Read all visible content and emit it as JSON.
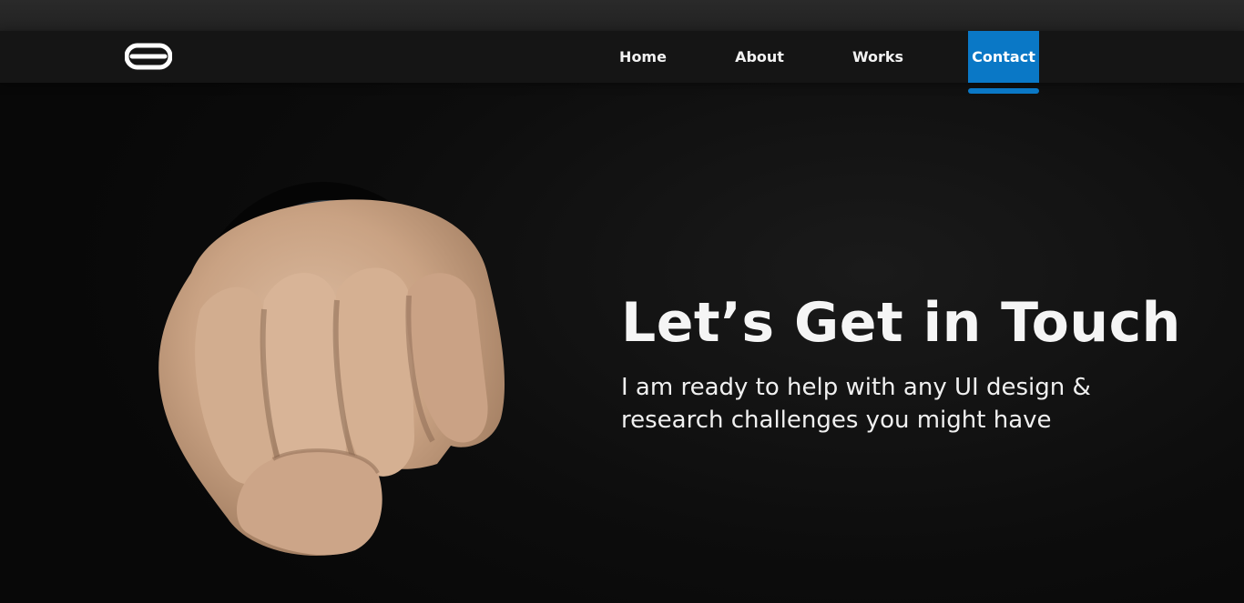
{
  "brand": {
    "logo_icon": "link-logo-icon"
  },
  "nav": {
    "items": [
      {
        "label": "Home"
      },
      {
        "label": "About"
      },
      {
        "label": "Works"
      },
      {
        "label": "Contact",
        "active": true
      }
    ],
    "accent_color": "#0a78c6"
  },
  "hero": {
    "image": "fist-bump-3d-icon",
    "headline": "Let’s Get in Touch",
    "subtext": "I am ready to help with any UI design & research challenges you might have"
  }
}
